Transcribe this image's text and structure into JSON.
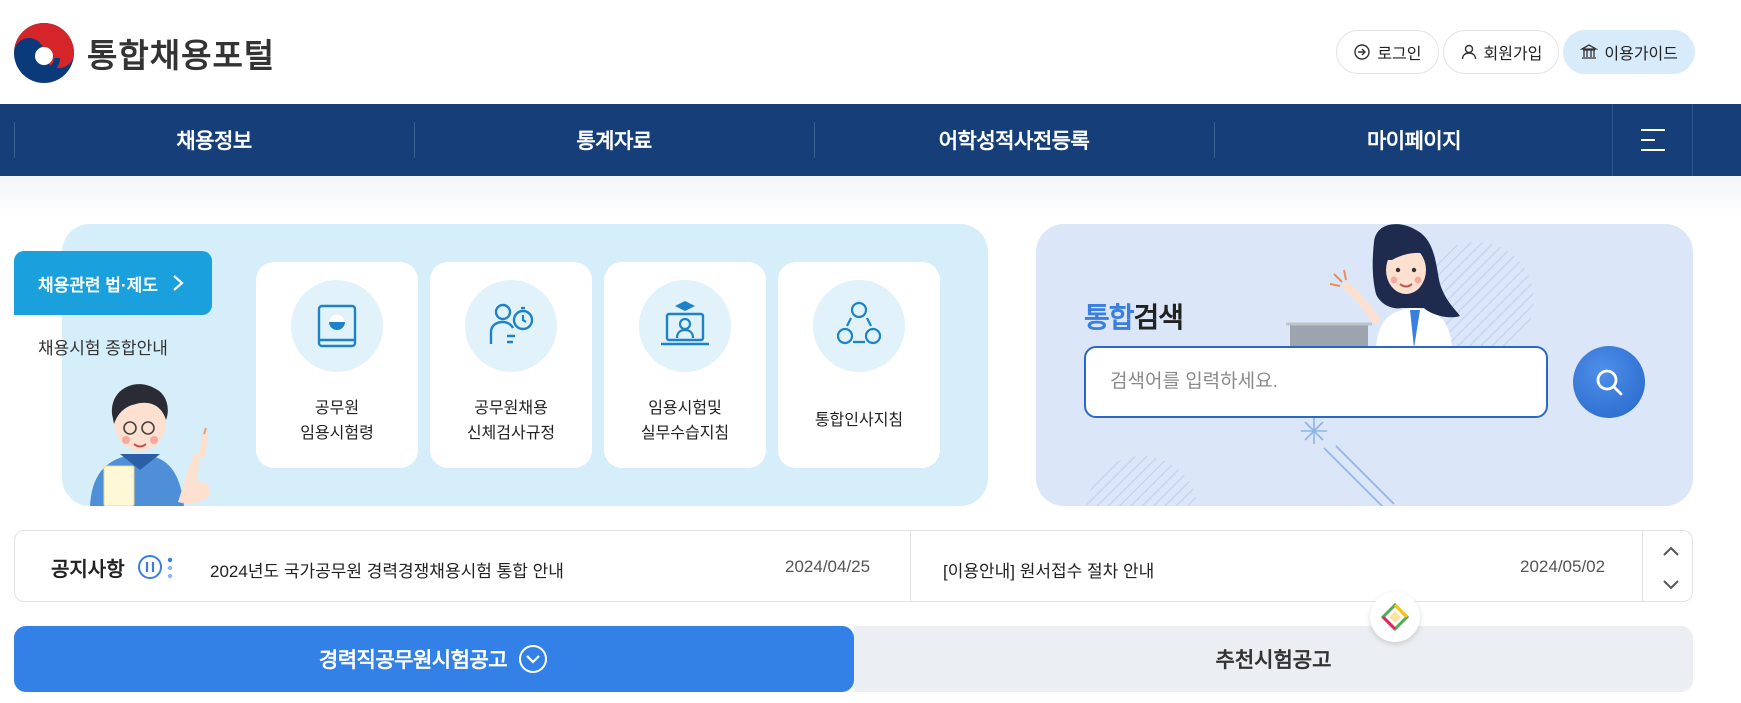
{
  "header": {
    "logo_text": "통합채용포털",
    "utility": {
      "login": "로그인",
      "signup": "회원가입",
      "guide": "이용가이드"
    }
  },
  "nav": {
    "items": [
      "채용정보",
      "통계자료",
      "어학성적사전등록",
      "마이페이지"
    ]
  },
  "left_panel": {
    "law_button": "채용관련 법·제도",
    "exam_guide": "채용시험 종합안내",
    "cards": [
      {
        "label": "공무원\n임용시험령",
        "icon": "book-seal-icon"
      },
      {
        "label": "공무원채용\n신체검사규정",
        "icon": "person-stopwatch-icon"
      },
      {
        "label": "임용시험및\n실무수습지침",
        "icon": "graduate-laptop-icon"
      },
      {
        "label": "통합인사지침",
        "icon": "people-network-icon"
      }
    ]
  },
  "search": {
    "title_accent": "통합",
    "title_rest": "검색",
    "placeholder": "검색어를 입력하세요."
  },
  "notice": {
    "title": "공지사항",
    "items": [
      {
        "text": "2024년도 국가공무원 경력경쟁채용시험 통합 안내",
        "date": "2024/04/25"
      },
      {
        "text": "[이용안내] 원서접수 절차 안내",
        "date": "2024/05/02"
      }
    ]
  },
  "tabs": {
    "career": "경력직공무원시험공고",
    "recommended": "추천시험공고"
  },
  "colors": {
    "nav_bg": "#163f7a",
    "primary_blue": "#3381e6",
    "sky": "#1aa1dd",
    "left_panel_bg": "#d6eef9",
    "right_panel_bg": "#dbe7f8"
  }
}
